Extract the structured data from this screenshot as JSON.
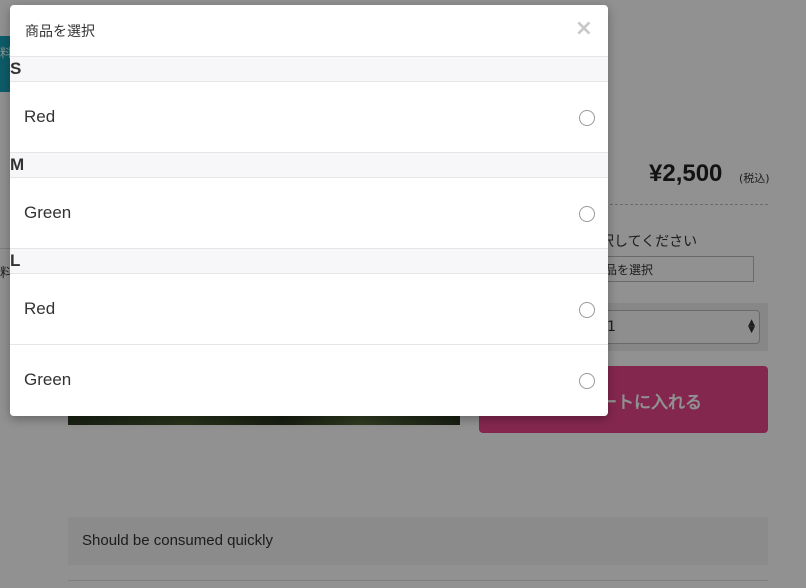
{
  "background": {
    "side_tab_text": "料)",
    "side_text": "料",
    "price": "¥2,500",
    "tax_label": "(税込)",
    "variant_label": "択してください",
    "variant_select_value": "品を選択",
    "quantity_value": "1",
    "cart_button_label": "ートに入れる",
    "description": "Should be consumed quickly",
    "colors": {
      "cart_button": "#e8458b",
      "side_tab": "#17a2b8"
    }
  },
  "modal": {
    "title": "商品を選択",
    "close_symbol": "×",
    "groups": [
      {
        "label": "S",
        "options": [
          {
            "label": "Red"
          }
        ]
      },
      {
        "label": "M",
        "options": [
          {
            "label": "Green"
          }
        ]
      },
      {
        "label": "L",
        "options": [
          {
            "label": "Red"
          },
          {
            "label": "Green"
          }
        ]
      }
    ]
  }
}
